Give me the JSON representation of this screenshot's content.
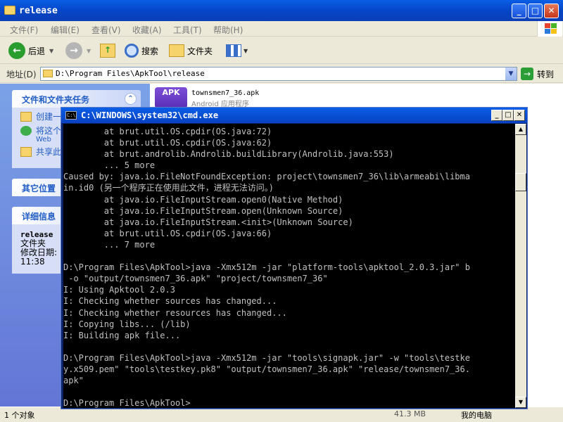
{
  "explorer": {
    "title": "release",
    "menu": [
      "文件(F)",
      "编辑(E)",
      "查看(V)",
      "收藏(A)",
      "工具(T)",
      "帮助(H)"
    ],
    "toolbar": {
      "back": "后退",
      "search": "搜索",
      "folders": "文件夹"
    },
    "address": {
      "label": "地址(D)",
      "value": "D:\\Program Files\\ApkTool\\release",
      "go": "转到"
    },
    "tasks_panel": {
      "title": "文件和文件夹任务",
      "items": [
        "创建一",
        "将这个",
        "共享此"
      ],
      "item2_sub": "Web"
    },
    "other_places": {
      "title": "其它位置"
    },
    "details": {
      "title": "详细信息",
      "name": "release",
      "type": "文件夹",
      "modified_label": "修改日期:",
      "modified_time": "11:38"
    },
    "file": {
      "icon_text": "APK",
      "name": "townsmen7_36.apk",
      "type": "Android 应用程序"
    },
    "status": {
      "left": "1 个对象",
      "size": "41.3 MB",
      "location": "我的电脑"
    }
  },
  "cmd": {
    "title": "C:\\WINDOWS\\system32\\cmd.exe",
    "lines": [
      "        at brut.util.OS.cpdir(OS.java:72)",
      "        at brut.util.OS.cpdir(OS.java:62)",
      "        at brut.androlib.Androlib.buildLibrary(Androlib.java:553)",
      "        ... 5 more",
      "Caused by: java.io.FileNotFoundException: project\\townsmen7_36\\lib\\armeabi\\libma",
      "in.id0 (另一个程序正在使用此文件，进程无法访问。)",
      "        at java.io.FileInputStream.open0(Native Method)",
      "        at java.io.FileInputStream.open(Unknown Source)",
      "        at java.io.FileInputStream.<init>(Unknown Source)",
      "        at brut.util.OS.cpdir(OS.java:66)",
      "        ... 7 more",
      "",
      "D:\\Program Files\\ApkTool>java -Xmx512m -jar \"platform-tools\\apktool_2.0.3.jar\" b",
      " -o \"output/townsmen7_36.apk\" \"project/townsmen7_36\"",
      "I: Using Apktool 2.0.3",
      "I: Checking whether sources has changed...",
      "I: Checking whether resources has changed...",
      "I: Copying libs... (/lib)",
      "I: Building apk file...",
      "",
      "D:\\Program Files\\ApkTool>java -Xmx512m -jar \"tools\\signapk.jar\" -w \"tools\\testke",
      "y.x509.pem\" \"tools\\testkey.pk8\" \"output/townsmen7_36.apk\" \"release/townsmen7_36.",
      "apk\"",
      "",
      "D:\\Program Files\\ApkTool>"
    ]
  }
}
